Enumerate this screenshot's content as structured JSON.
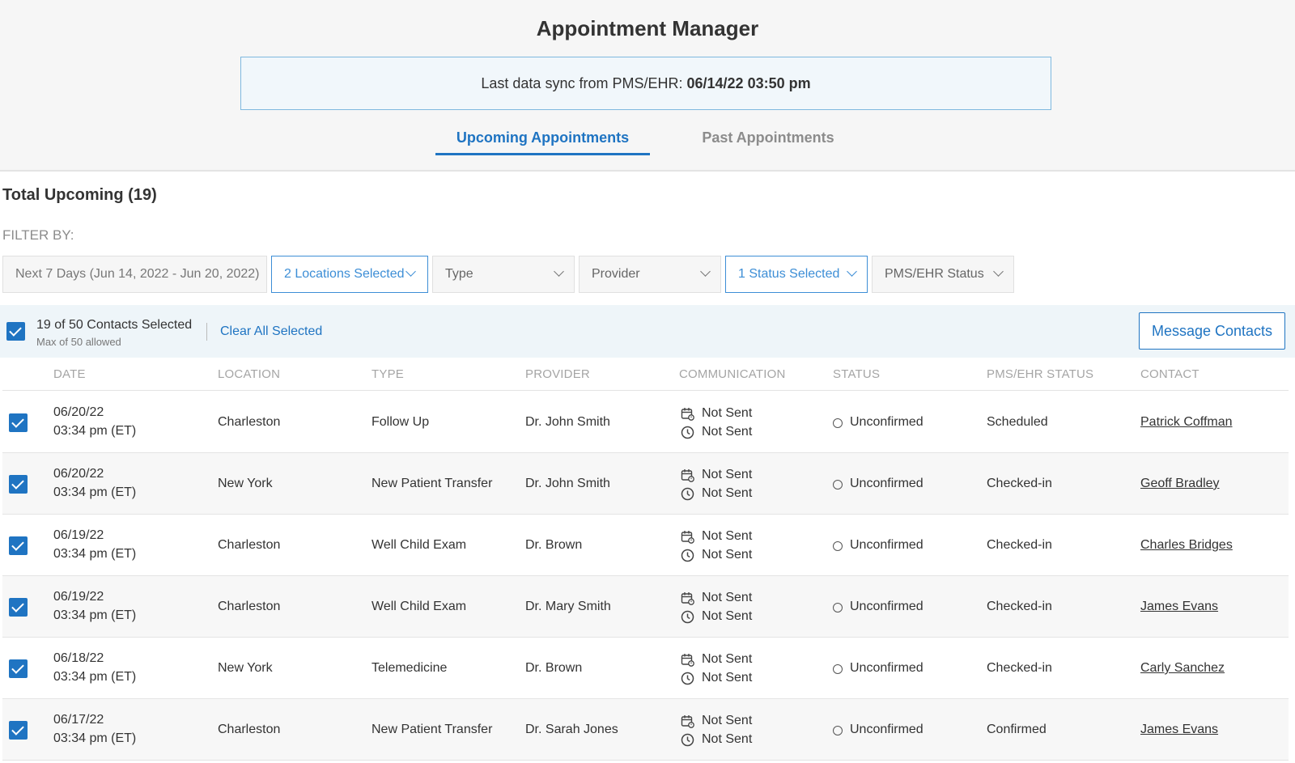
{
  "header": {
    "title": "Appointment Manager",
    "sync_label": "Last data sync from PMS/EHR:",
    "sync_value": "06/14/22 03:50 pm",
    "tabs": [
      {
        "label": "Upcoming Appointments",
        "active": true
      },
      {
        "label": "Past Appointments",
        "active": false
      }
    ]
  },
  "summary": {
    "total": "Total Upcoming (19)",
    "filter_by": "FILTER BY:"
  },
  "filters": {
    "date": "Next 7 Days (Jun 14, 2022 - Jun 20, 2022)",
    "locations": "2 Locations Selected",
    "type": "Type",
    "provider": "Provider",
    "status": "1 Status Selected",
    "pms_status": "PMS/EHR Status"
  },
  "selection": {
    "count": "19 of 50 Contacts Selected",
    "max": "Max of 50 allowed",
    "clear_label": "Clear All Selected",
    "message_label": "Message Contacts"
  },
  "columns": [
    "DATE",
    "LOCATION",
    "TYPE",
    "PROVIDER",
    "COMMUNICATION",
    "STATUS",
    "PMS/EHR STATUS",
    "CONTACT"
  ],
  "rows": [
    {
      "date": "06/20/22",
      "time": "03:34 pm (ET)",
      "location": "Charleston",
      "type": "Follow Up",
      "provider": "Dr. John Smith",
      "comm1": "Not Sent",
      "comm2": "Not Sent",
      "status": "Unconfirmed",
      "pms": "Scheduled",
      "contact": "Patrick Coffman",
      "checked": true
    },
    {
      "date": "06/20/22",
      "time": "03:34 pm (ET)",
      "location": "New York",
      "type": "New Patient Transfer",
      "provider": "Dr. John Smith",
      "comm1": "Not Sent",
      "comm2": "Not Sent",
      "status": "Unconfirmed",
      "pms": "Checked-in",
      "contact": "Geoff Bradley",
      "checked": true
    },
    {
      "date": "06/19/22",
      "time": "03:34 pm (ET)",
      "location": "Charleston",
      "type": "Well Child Exam",
      "provider": "Dr. Brown",
      "comm1": "Not Sent",
      "comm2": "Not Sent",
      "status": "Unconfirmed",
      "pms": "Checked-in",
      "contact": "Charles Bridges",
      "checked": true
    },
    {
      "date": "06/19/22",
      "time": "03:34 pm (ET)",
      "location": "Charleston",
      "type": "Well Child Exam",
      "provider": "Dr. Mary Smith",
      "comm1": "Not Sent",
      "comm2": "Not Sent",
      "status": "Unconfirmed",
      "pms": "Checked-in",
      "contact": "James Evans",
      "checked": true
    },
    {
      "date": "06/18/22",
      "time": "03:34 pm (ET)",
      "location": "New York",
      "type": "Telemedicine",
      "provider": "Dr. Brown",
      "comm1": "Not Sent",
      "comm2": "Not Sent",
      "status": "Unconfirmed",
      "pms": "Checked-in",
      "contact": "Carly Sanchez",
      "checked": true
    },
    {
      "date": "06/17/22",
      "time": "03:34 pm (ET)",
      "location": "Charleston",
      "type": "New Patient Transfer",
      "provider": "Dr. Sarah Jones",
      "comm1": "Not Sent",
      "comm2": "Not Sent",
      "status": "Unconfirmed",
      "pms": "Confirmed",
      "contact": "James Evans",
      "checked": true
    }
  ]
}
